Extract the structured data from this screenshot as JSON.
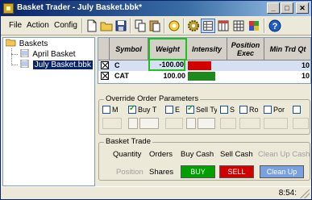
{
  "window": {
    "title": "Basket Trader - July Basket.bbk*",
    "controls": [
      "_",
      "□",
      "✕"
    ]
  },
  "menu": {
    "items": [
      {
        "label": "File"
      },
      {
        "label": "Action"
      },
      {
        "label": "Config"
      }
    ]
  },
  "toolbar": {
    "tools": [
      "new-file-icon",
      "open-folder-icon",
      "save-icon",
      "copy-icon",
      "paste-icon",
      "cut-icon",
      "import-icon",
      "export-icon",
      "transmit-icon",
      "settings-gear-icon",
      "grid-view-icon",
      "columns-icon",
      "calculator-icon",
      "colors-icon",
      "help-icon"
    ]
  },
  "tree": {
    "root": "Baskets",
    "items": [
      "April Basket",
      "July Basket.bbk"
    ]
  },
  "grid": {
    "headers": [
      "Symbol",
      "Weight",
      "Intensity",
      "Position Exec",
      "Min Trd Qt"
    ],
    "rows": [
      {
        "symbol": "C",
        "weight": "-100.00",
        "intensity_color": "#d40000",
        "intensity": 0.6,
        "last": "10"
      },
      {
        "symbol": "CAT",
        "weight": "100.00",
        "intensity_color": "#1e8a1e",
        "intensity": 0.7,
        "last": "10"
      }
    ]
  },
  "override": {
    "title": "Override Order Parameters",
    "checkboxes": [
      {
        "label": "M",
        "checked": false
      },
      {
        "label": "Buy T",
        "checked": true
      },
      {
        "label": "E",
        "checked": false
      },
      {
        "label": "Sell Ty",
        "checked": true
      },
      {
        "label": "S",
        "checked": false
      },
      {
        "label": "Ro",
        "checked": false
      },
      {
        "label": "Por",
        "checked": false
      },
      {
        "label": "",
        "checked": false
      }
    ]
  },
  "basket_trade": {
    "title": "Basket Trade",
    "labels": [
      "Quantity",
      "Orders",
      "Buy Cash",
      "Sell Cash",
      "Clean Up Cash"
    ],
    "row2": {
      "position": "Position",
      "shares": "Shares"
    },
    "buy": "BUY",
    "sell": "SELL",
    "cleanup": "Clean Up",
    "colors": {
      "buy": "#00a000",
      "sell": "#d00000",
      "cleanup": "#7aa0e0"
    }
  },
  "status": {
    "clock": "8:54:"
  }
}
